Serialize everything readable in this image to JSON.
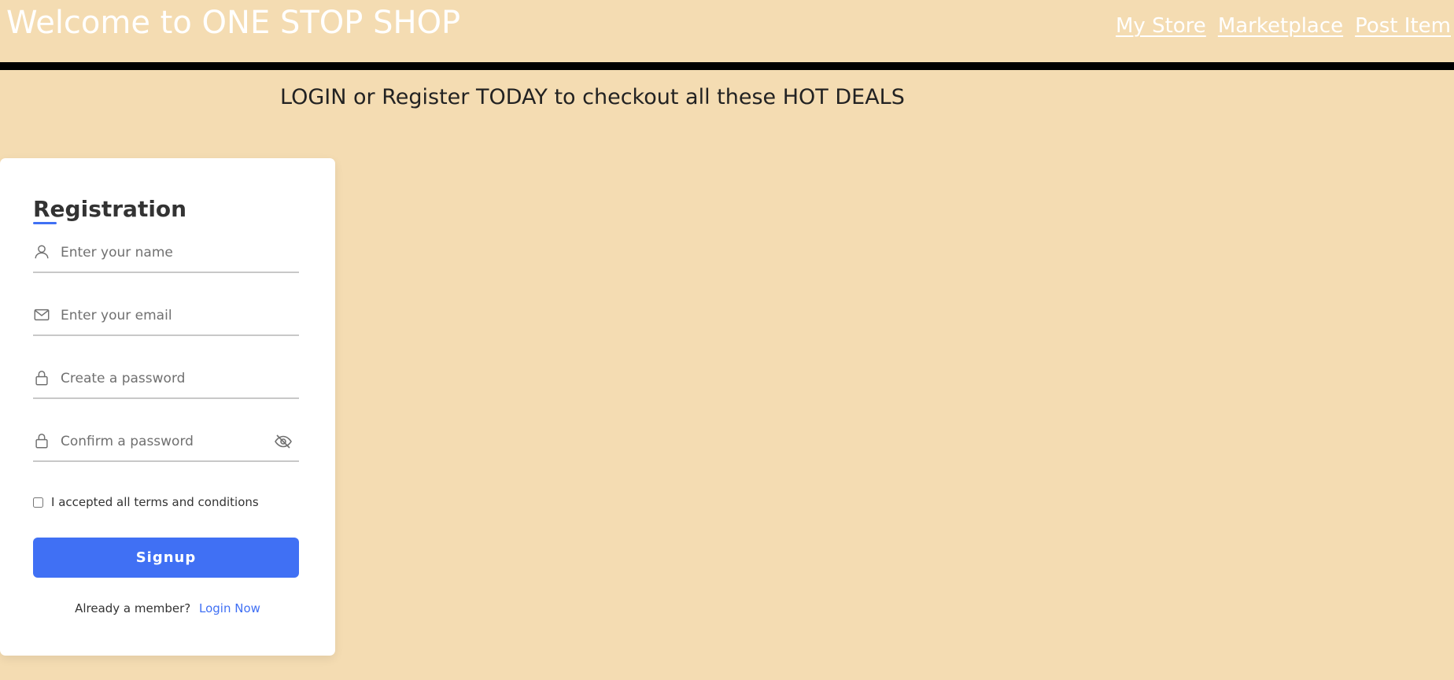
{
  "header": {
    "title": "Welcome to ONE STOP SHOP",
    "nav": [
      {
        "label": "My Store"
      },
      {
        "label": "Marketplace"
      },
      {
        "label": "Post Item"
      }
    ]
  },
  "promo": {
    "text": "LOGIN or Register TODAY to checkout all these HOT DEALS"
  },
  "registration": {
    "title": "Registration",
    "fields": {
      "name": {
        "placeholder": "Enter your name",
        "value": "",
        "icon": "user-icon"
      },
      "email": {
        "placeholder": "Enter your email",
        "value": "",
        "icon": "envelope-icon"
      },
      "password": {
        "placeholder": "Create a password",
        "value": "",
        "icon": "lock-icon"
      },
      "confirm": {
        "placeholder": "Confirm a password",
        "value": "",
        "icon": "lock-icon",
        "toggle_icon": "eye-slash-icon"
      }
    },
    "terms_label": "I accepted all terms and conditions",
    "terms_checked": false,
    "signup_label": "Signup",
    "member_text": "Already a member?",
    "login_link": "Login Now"
  },
  "colors": {
    "background": "#f4dcb2",
    "accent": "#4070f4",
    "rule": "#000000",
    "card": "#ffffff"
  }
}
